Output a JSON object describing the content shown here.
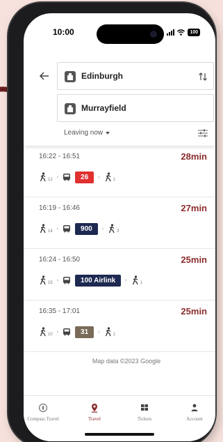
{
  "status_bar": {
    "time": "10:00",
    "battery": "100"
  },
  "search": {
    "from": "Edinburgh",
    "to": "Murrayfield",
    "leaving": "Leaving now"
  },
  "routes": [
    {
      "times": "16:22 - 16:51",
      "duration": "28min",
      "walk1": "12",
      "service": "26",
      "walk2": "1",
      "color": "#e03030"
    },
    {
      "times": "16:19 - 16:46",
      "duration": "27min",
      "walk1": "14",
      "service": "900",
      "walk2": "3",
      "color": "#1d2951"
    },
    {
      "times": "16:24 - 16:50",
      "duration": "25min",
      "walk1": "15",
      "service": "100 Airlink",
      "walk2": "1",
      "color": "#1d2951"
    },
    {
      "times": "16:35 - 17:01",
      "duration": "25min",
      "walk1": "10",
      "service": "31",
      "walk2": "1",
      "color": "#7a6a58"
    }
  ],
  "map_credit": "Map data ©2023 Google",
  "nav": {
    "items": [
      {
        "label": "Compass Travel",
        "icon": "compass-icon"
      },
      {
        "label": "Travel",
        "icon": "location-pin-icon"
      },
      {
        "label": "Tickets",
        "icon": "ticket-icon"
      },
      {
        "label": "Account",
        "icon": "person-icon"
      }
    ]
  },
  "colors": {
    "accent": "#8b2c2c",
    "background": "#f7e1dc"
  }
}
